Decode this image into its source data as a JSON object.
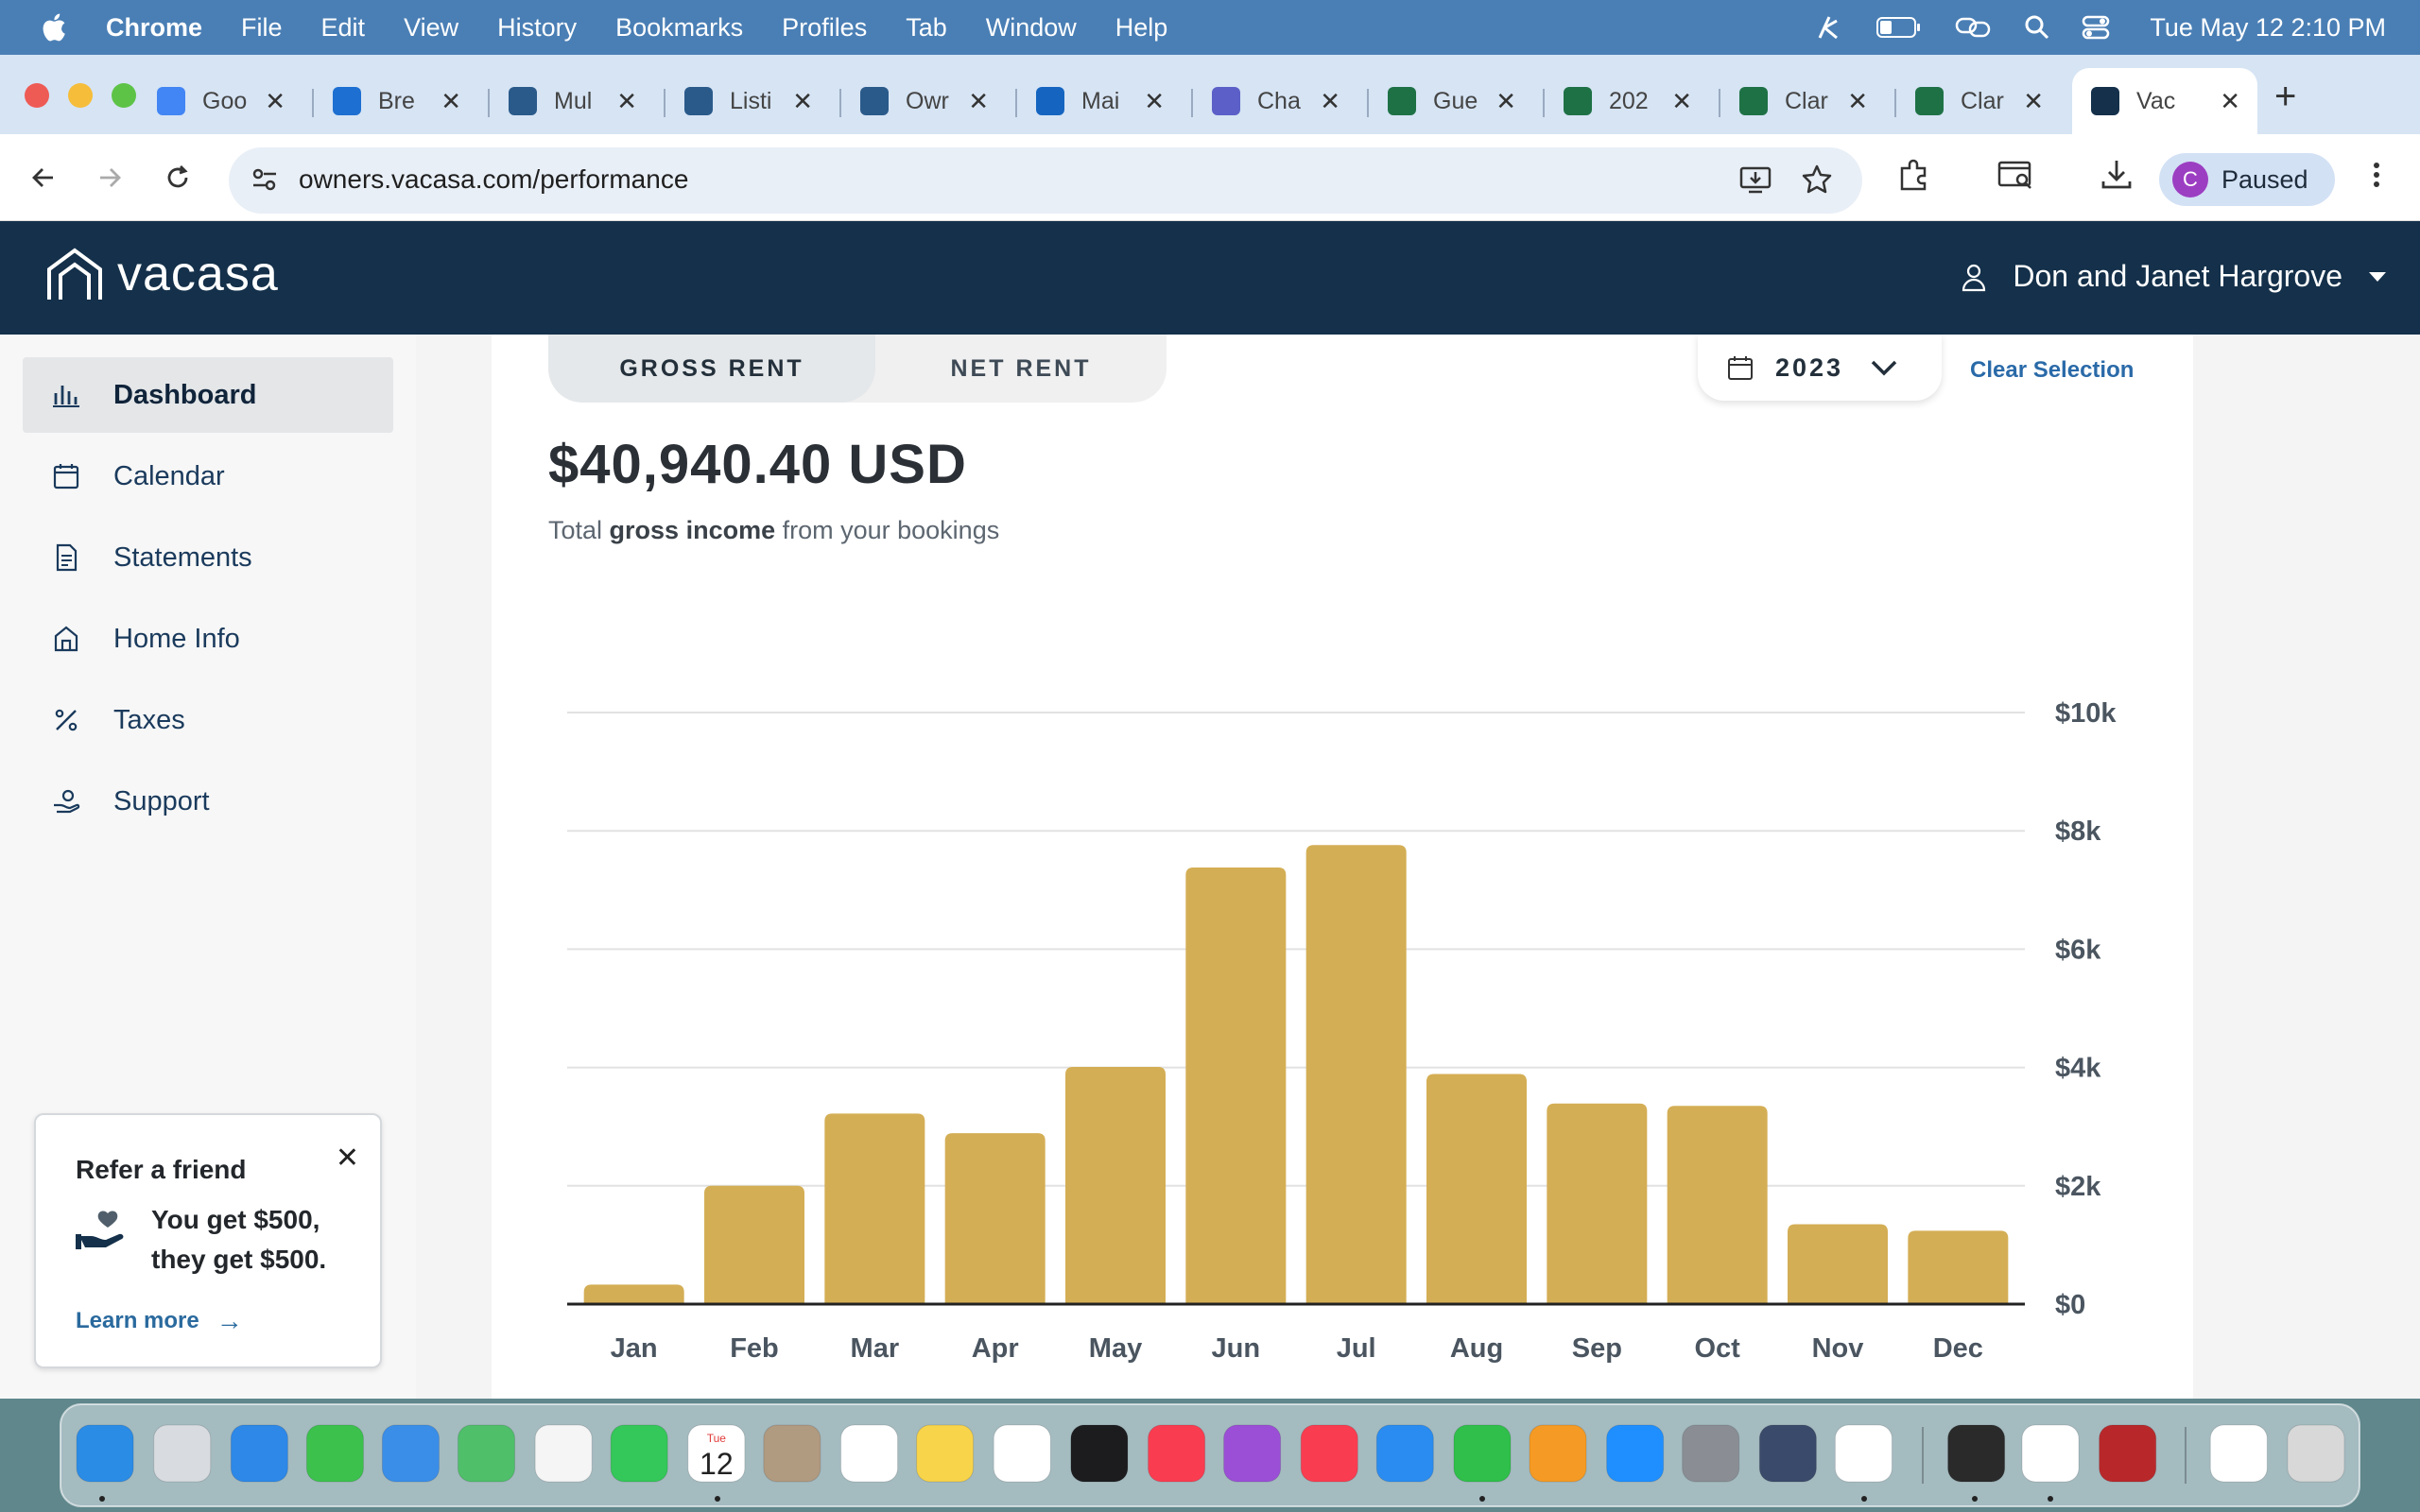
{
  "menubar": {
    "app": "Chrome",
    "items": [
      "File",
      "Edit",
      "View",
      "History",
      "Bookmarks",
      "Profiles",
      "Tab",
      "Window",
      "Help"
    ],
    "clock": "Tue May 12  2:10 PM"
  },
  "tabs": [
    {
      "label": "Goo",
      "color": "#4285f4"
    },
    {
      "label": "Bre",
      "color": "#1d6fd1"
    },
    {
      "label": "Mul",
      "color": "#2a5a8a"
    },
    {
      "label": "Listi",
      "color": "#2a5a8a"
    },
    {
      "label": "Owr",
      "color": "#2a5a8a"
    },
    {
      "label": "Mai",
      "color": "#1565c0"
    },
    {
      "label": "Cha",
      "color": "#5b5fc7"
    },
    {
      "label": "Gue",
      "color": "#1e7145"
    },
    {
      "label": "202",
      "color": "#1e7145"
    },
    {
      "label": "Clar",
      "color": "#1e7145"
    },
    {
      "label": "Clar",
      "color": "#1e7145"
    },
    {
      "label": "Vac",
      "color": "#14304a",
      "active": true
    }
  ],
  "toolbar": {
    "url": "owners.vacasa.com/performance",
    "profile_initial": "C",
    "profile_status": "Paused"
  },
  "header": {
    "brand": "vacasa",
    "user_name": "Don and Janet Hargrove"
  },
  "sidebar": {
    "items": [
      {
        "label": "Dashboard",
        "icon": "bar-chart-icon",
        "active": true
      },
      {
        "label": "Calendar",
        "icon": "calendar-icon"
      },
      {
        "label": "Statements",
        "icon": "document-icon"
      },
      {
        "label": "Home Info",
        "icon": "home-icon"
      },
      {
        "label": "Taxes",
        "icon": "percent-icon"
      },
      {
        "label": "Support",
        "icon": "support-icon"
      }
    ],
    "refer": {
      "title": "Refer a friend",
      "text_line1": "You get $500,",
      "text_line2": "they get $500.",
      "link": "Learn more"
    }
  },
  "performance": {
    "toggle_gross": "GROSS RENT",
    "toggle_net": "NET RENT",
    "year": "2023",
    "clear": "Clear Selection",
    "total": "$40,940.40 USD",
    "sub_prefix": "Total ",
    "sub_bold": "gross income",
    "sub_suffix": " from your bookings"
  },
  "chart_data": {
    "type": "bar",
    "categories": [
      "Jan",
      "Feb",
      "Mar",
      "Apr",
      "May",
      "Jun",
      "Jul",
      "Aug",
      "Sep",
      "Oct",
      "Nov",
      "Dec"
    ],
    "values": [
      330,
      2000,
      3220,
      2890,
      4010,
      7380,
      7760,
      3890,
      3390,
      3350,
      1350,
      1240
    ],
    "ylim": [
      0,
      10000
    ],
    "yticks": [
      0,
      2000,
      4000,
      6000,
      8000,
      10000
    ],
    "ytick_labels": [
      "$0",
      "$2k",
      "$4k",
      "$6k",
      "$8k",
      "$10k"
    ],
    "bar_color": "#d4ae55",
    "grid": true,
    "axis_side": "right"
  },
  "dock": {
    "apps": [
      "Finder",
      "Launchpad",
      "Safari",
      "Messages",
      "Mail",
      "Maps",
      "Photos",
      "FaceTime",
      "Calendar",
      "Contacts",
      "Reminders",
      "Notes",
      "Freeform",
      "TV",
      "Music",
      "Podcasts",
      "News",
      "Keynote",
      "Numbers",
      "Pages",
      "App Store",
      "System Settings",
      "iPhone Mirroring",
      "Chrome",
      "Preview",
      "TextEdit",
      "Dictionary",
      "Files",
      "Trash"
    ],
    "calendar_day": "12",
    "calendar_month": "Tue"
  }
}
